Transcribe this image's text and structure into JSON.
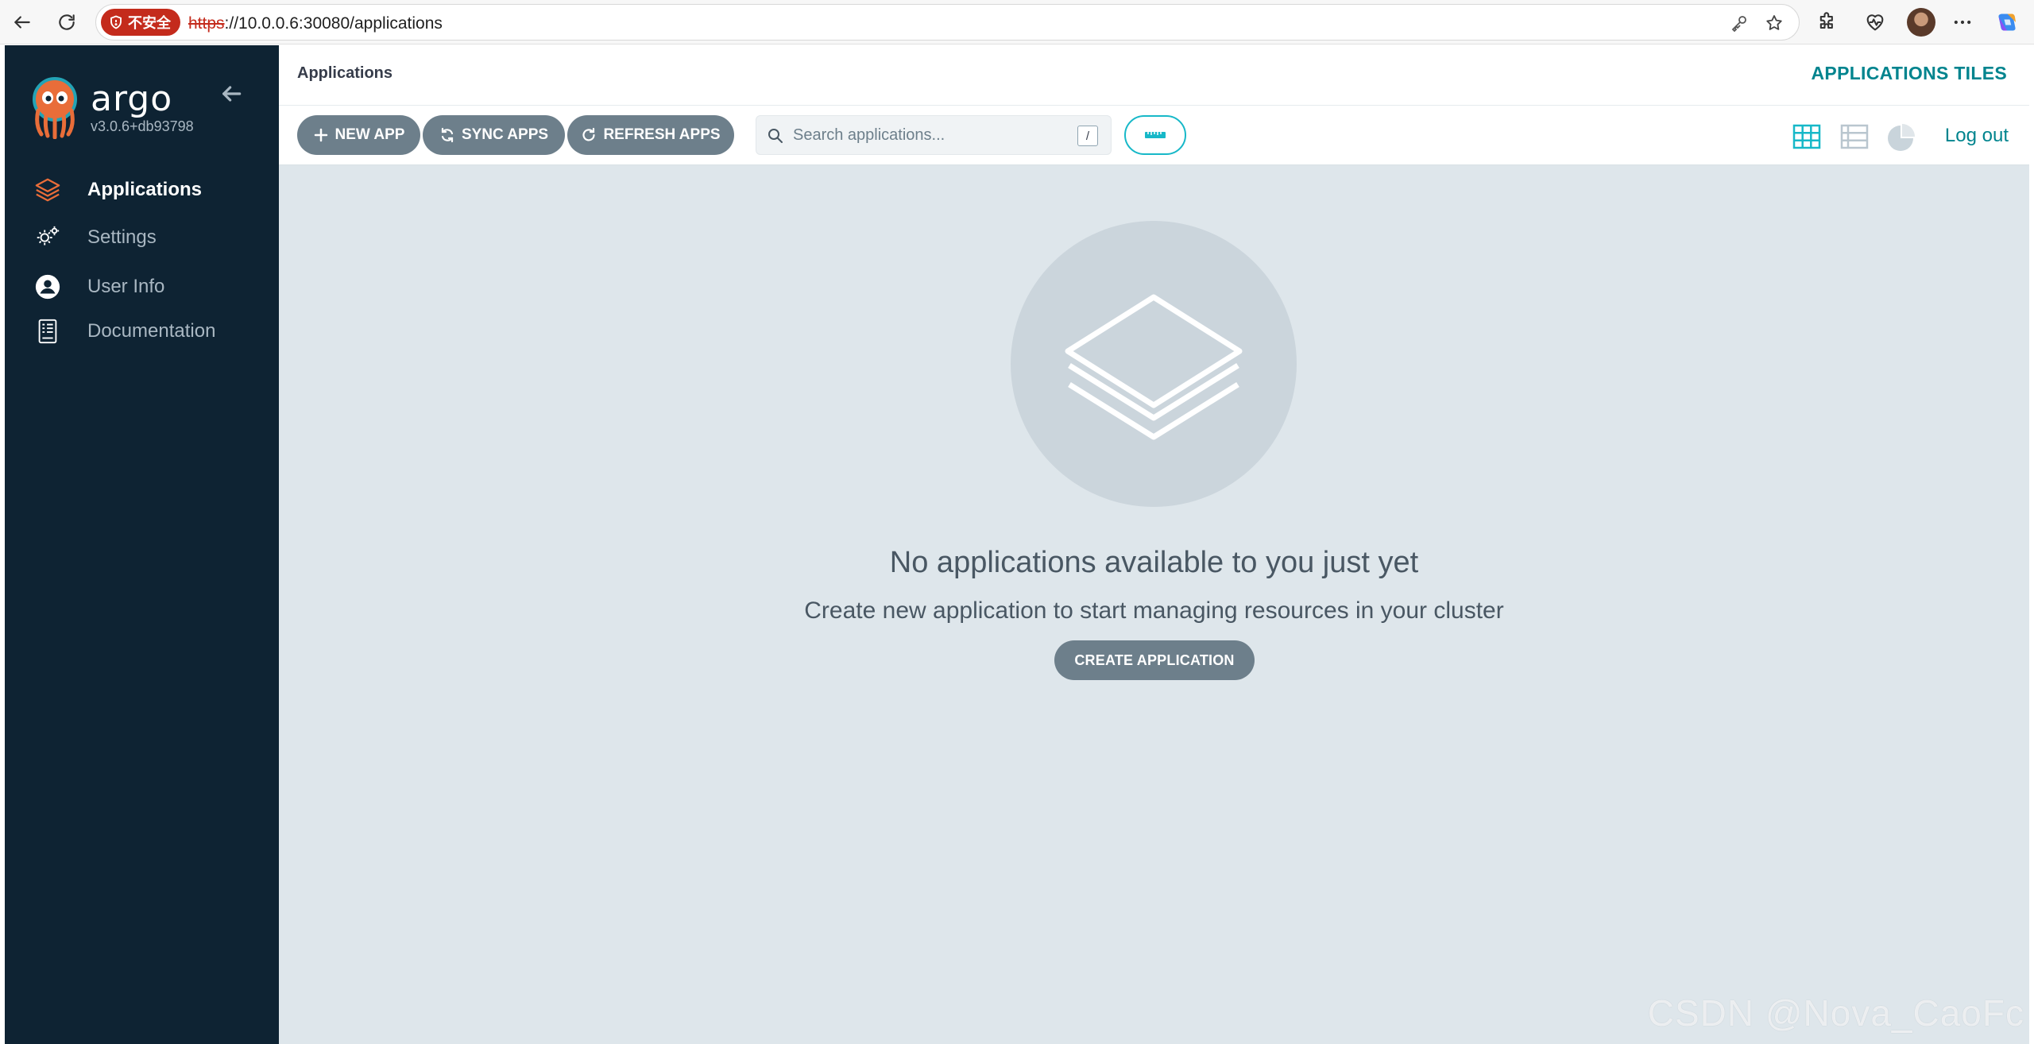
{
  "browser": {
    "security_badge": "不安全",
    "url_protocol": "https",
    "url_rest": "://10.0.0.6:30080/applications",
    "icons": [
      "back-arrow-icon",
      "reload-icon",
      "key-icon",
      "star-icon",
      "extensions-icon",
      "health-icon",
      "more-icon",
      "copilot-icon"
    ]
  },
  "sidebar": {
    "brand": "argo",
    "version": "v3.0.6+db93798",
    "items": [
      {
        "label": "Applications",
        "icon": "layers-icon",
        "active": true
      },
      {
        "label": "Settings",
        "icon": "gears-icon",
        "active": false
      },
      {
        "label": "User Info",
        "icon": "user-circle-icon",
        "active": false
      },
      {
        "label": "Documentation",
        "icon": "book-icon",
        "active": false
      }
    ]
  },
  "header": {
    "breadcrumb": "Applications",
    "title": "APPLICATIONS TILES"
  },
  "toolbar": {
    "new_app": "NEW APP",
    "sync_apps": "SYNC APPS",
    "refresh_apps": "REFRESH APPS",
    "search_placeholder": "Search applications...",
    "search_shortcut": "/",
    "logout": "Log out",
    "views": [
      "tiles-view-icon",
      "list-view-icon",
      "pie-chart-view-icon"
    ]
  },
  "empty_state": {
    "title": "No applications available to you just yet",
    "subtitle": "Create new application to start managing resources in your cluster",
    "button": "CREATE APPLICATION"
  },
  "watermark": "CSDN @Nova_CaoFc",
  "colors": {
    "sidebar_bg": "#0e2333",
    "accent_teal": "#00848e",
    "button_gray": "#6d7f8b",
    "content_bg": "#dee6eb",
    "orange_active": "#e96d39"
  }
}
